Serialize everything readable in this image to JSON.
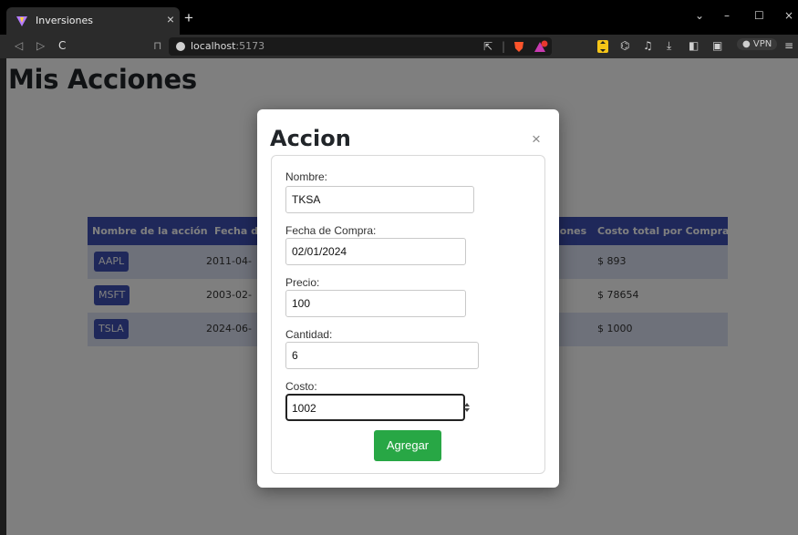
{
  "browser": {
    "tab_title": "Inversiones",
    "tab_close": "×",
    "new_tab": "+",
    "url_host": "localhost",
    "url_port": ":5173",
    "vpn_label": "VPN",
    "window_controls": {
      "minimize": "–",
      "maximize": "☐",
      "close": "×",
      "dropdown": "⌄"
    },
    "nav": {
      "back": "◁",
      "forward": "▷",
      "reload": "C",
      "bookmark": "⊓"
    }
  },
  "page": {
    "title": "Mis Acciones",
    "table": {
      "headers": [
        "Nombre de la acción",
        "Fecha de",
        "iones",
        "Costo total por Compra"
      ],
      "rows": [
        {
          "ticker": "AAPL",
          "date": "2011-04-",
          "cost": "$ 893"
        },
        {
          "ticker": "MSFT",
          "date": "2003-02-",
          "cost": "$ 78654"
        },
        {
          "ticker": "TSLA",
          "date": "2024-06-",
          "cost": "$ 1000"
        }
      ]
    }
  },
  "modal": {
    "title": "Accion",
    "close": "×",
    "fields": {
      "nombre": {
        "label": "Nombre:",
        "value": "TKSA"
      },
      "fecha": {
        "label": "Fecha de Compra:",
        "value": "02/01/2024"
      },
      "precio": {
        "label": "Precio:",
        "value": "100"
      },
      "cantidad": {
        "label": "Cantidad:",
        "value": "6"
      },
      "costo": {
        "label": "Costo:",
        "value": "1002"
      }
    },
    "submit_label": "Agregar"
  },
  "colors": {
    "table_header": "#3f51b5",
    "row_stripe": "#dde3f5",
    "submit_button": "#28a745"
  }
}
